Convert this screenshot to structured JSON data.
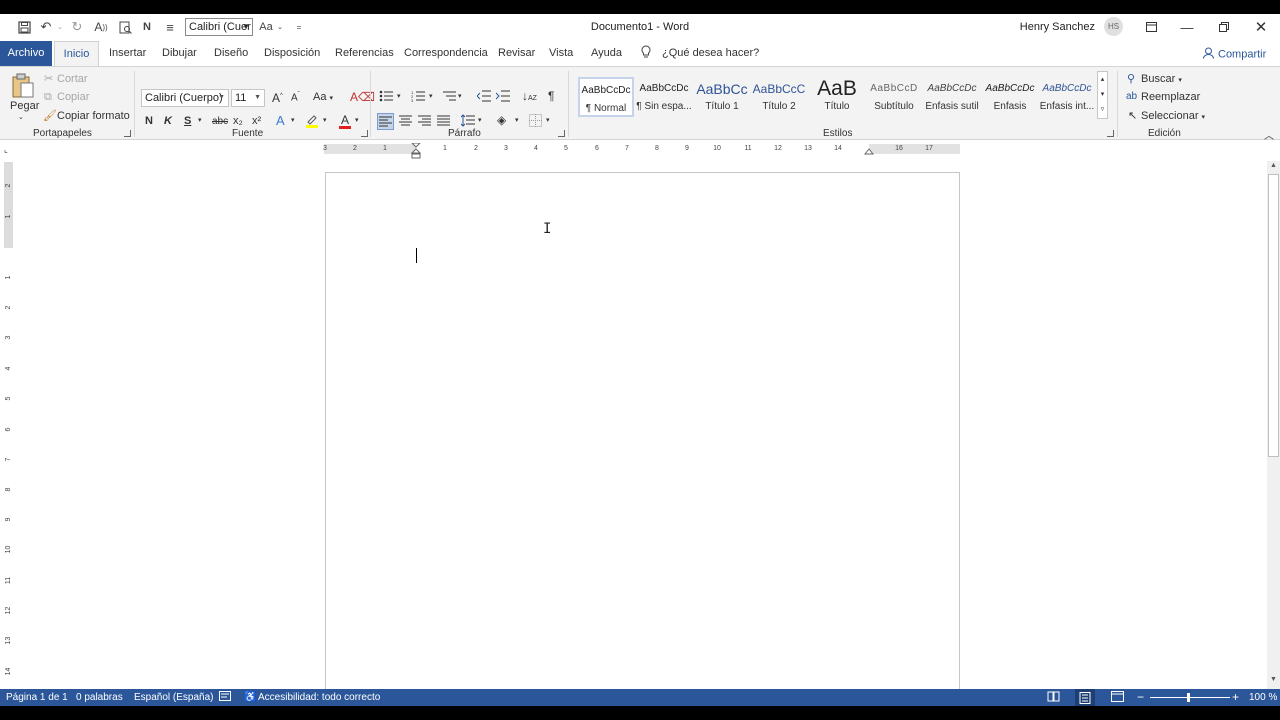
{
  "titlebar": {
    "doc_title": "Documento1  -  Word",
    "user_name": "Henry Sanchez",
    "avatar_initials": "HS",
    "qa_font": "Calibri (Cuer",
    "qa_fontsize_icon": "Aa",
    "qa_normal": "N"
  },
  "tabs": [
    "Archivo",
    "Inicio",
    "Insertar",
    "Dibujar",
    "Diseño",
    "Disposición",
    "Referencias",
    "Correspondencia",
    "Revisar",
    "Vista",
    "Ayuda"
  ],
  "tell_me": "¿Qué desea hacer?",
  "share": "Compartir",
  "clipboard": {
    "paste": "Pegar",
    "cut": "Cortar",
    "copy": "Copiar",
    "format_painter": "Copiar formato",
    "label": "Portapapeles"
  },
  "font": {
    "name": "Calibri (Cuerpo)",
    "size": "11",
    "label": "Fuente",
    "bold": "N",
    "italic": "K",
    "underline": "S",
    "strike": "abc",
    "sub": "x₂",
    "sup": "x²",
    "grow": "A",
    "case": "Aa"
  },
  "paragraph": {
    "label": "Párrafo"
  },
  "styles": {
    "label": "Estilos",
    "items": [
      {
        "preview": "AaBbCcDc",
        "name": "¶ Normal"
      },
      {
        "preview": "AaBbCcDc",
        "name": "¶ Sin espa..."
      },
      {
        "preview": "AaBbCc",
        "name": "Título 1"
      },
      {
        "preview": "AaBbCcC",
        "name": "Título 2"
      },
      {
        "preview": "AaB",
        "name": "Título"
      },
      {
        "preview": "AaBbCcD",
        "name": "Subtítulo"
      },
      {
        "preview": "AaBbCcDc",
        "name": "Énfasis sutil"
      },
      {
        "preview": "AaBbCcDc",
        "name": "Énfasis"
      },
      {
        "preview": "AaBbCcDc",
        "name": "Énfasis int..."
      }
    ]
  },
  "editing": {
    "find": "Buscar",
    "replace": "Reemplazar",
    "select": "Seleccionar",
    "label": "Edición"
  },
  "ruler": {
    "h_numbers": [
      "3",
      "2",
      "1",
      "1",
      "2",
      "3",
      "4",
      "5",
      "6",
      "7",
      "8",
      "9",
      "10",
      "11",
      "12",
      "13",
      "14",
      "16",
      "17"
    ],
    "v_numbers": [
      "2",
      "1",
      "1",
      "2",
      "3",
      "4",
      "5",
      "6",
      "7",
      "8",
      "9",
      "10",
      "11",
      "12",
      "13",
      "14"
    ]
  },
  "status": {
    "page": "Página 1 de 1",
    "words": "0 palabras",
    "language": "Español (España)",
    "accessibility": "Accesibilidad: todo correcto",
    "zoom": "100 %"
  }
}
